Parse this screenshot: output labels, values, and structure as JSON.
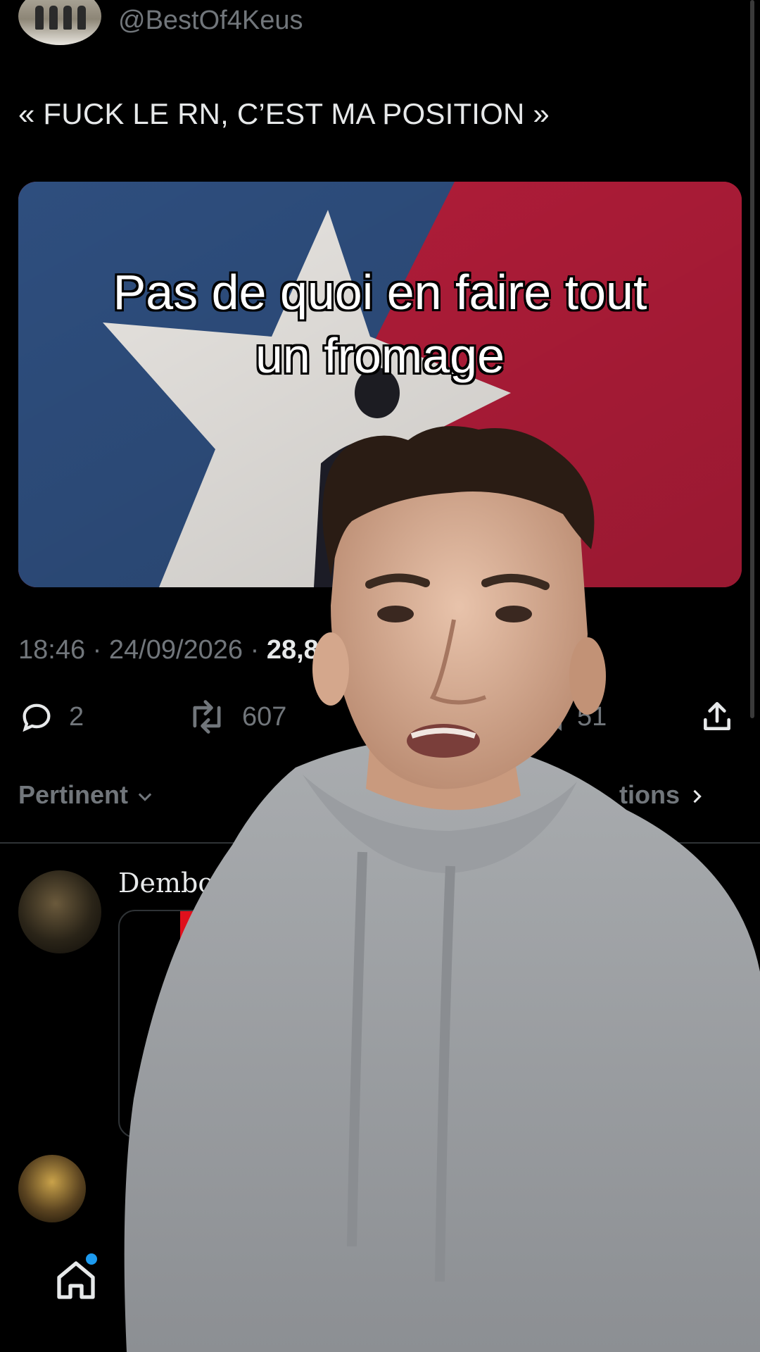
{
  "tweet": {
    "handle": "@BestOf4Keus",
    "text": "« FUCK LE RN, C’EST MA POSITION »",
    "time_date": "18:46 · 24/09/2026 · ",
    "views_partial": "28,8"
  },
  "actions": {
    "replies": "2",
    "reposts": "607",
    "bookmarks": "51"
  },
  "sort": {
    "label": "Pertinent",
    "more_label": "tions"
  },
  "reply": {
    "name": "Dembouz"
  },
  "overlay_caption": {
    "line1": "Pas de quoi en faire tout",
    "line2": "un fromage"
  },
  "icons": [
    "reply-icon",
    "repost-icon",
    "bookmark-icon",
    "share-icon",
    "chevron-down-icon",
    "chevron-right-icon",
    "home-icon"
  ],
  "colors": {
    "background": "#000000",
    "text_primary": "#e7e9ea",
    "text_secondary": "#71767b",
    "accent": "#1d9bf0",
    "flag_blue": "#2e4e7e",
    "flag_red": "#b41d3a"
  }
}
